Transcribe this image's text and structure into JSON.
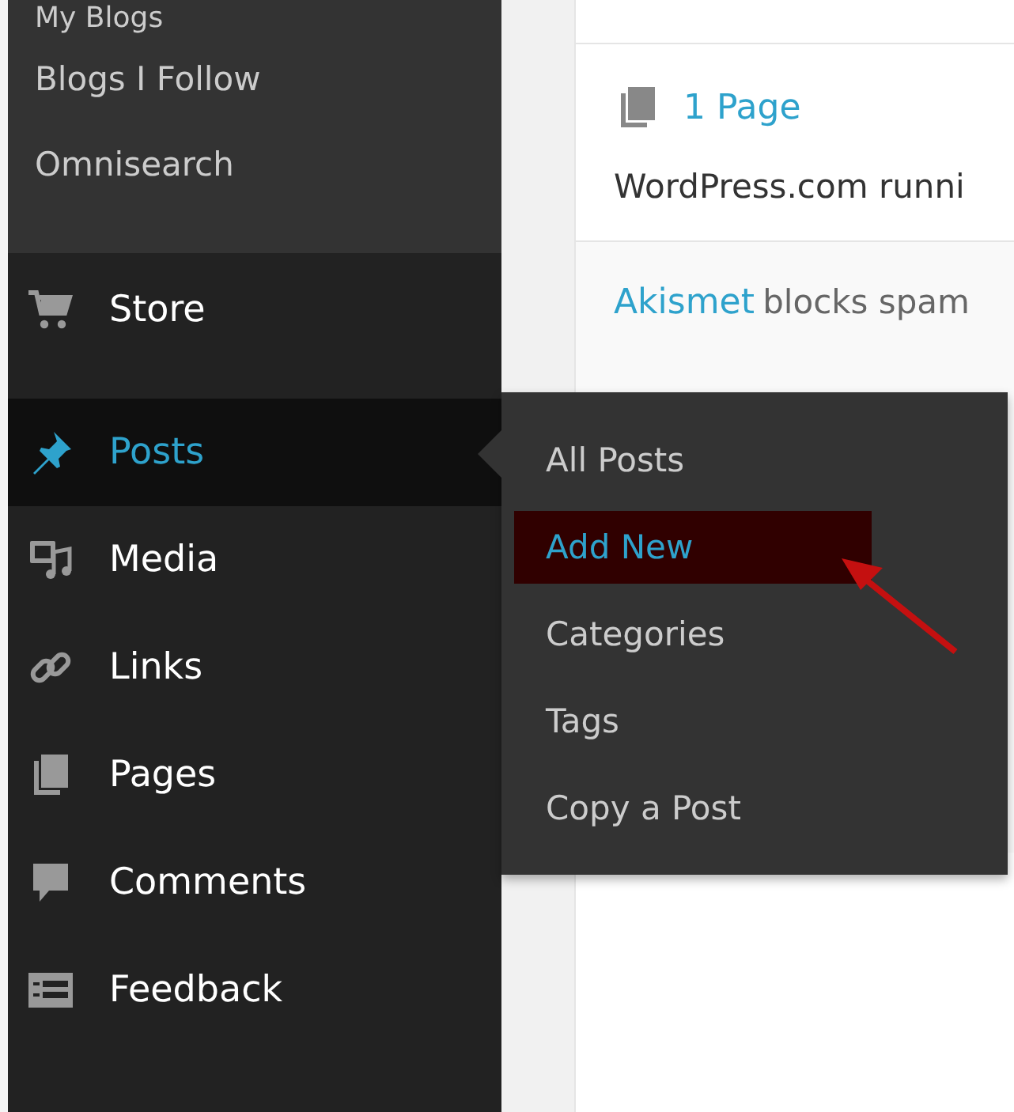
{
  "sidebar": {
    "submenu_items": [
      {
        "label": "My Blogs"
      },
      {
        "label": "Blogs I Follow"
      },
      {
        "label": "Omnisearch"
      }
    ],
    "menu_items": [
      {
        "label": "Store",
        "kind": "cart",
        "selected": false
      },
      {
        "label": "Posts",
        "kind": "pin",
        "selected": true
      },
      {
        "label": "Media",
        "kind": "media",
        "selected": false
      },
      {
        "label": "Links",
        "kind": "link",
        "selected": false
      },
      {
        "label": "Pages",
        "kind": "pages",
        "selected": false
      },
      {
        "label": "Comments",
        "kind": "comment",
        "selected": false
      },
      {
        "label": "Feedback",
        "kind": "feedback",
        "selected": false
      }
    ]
  },
  "flyout": {
    "items": [
      {
        "label": "All Posts",
        "selected": false
      },
      {
        "label": "Add New",
        "selected": true
      },
      {
        "label": "Categories",
        "selected": false
      },
      {
        "label": "Tags",
        "selected": false
      },
      {
        "label": "Copy a Post",
        "selected": false
      }
    ]
  },
  "content": {
    "page_count": "1 Page",
    "description": "WordPress.com runni",
    "notice_link": "Akismet",
    "notice_text": "blocks spam"
  }
}
